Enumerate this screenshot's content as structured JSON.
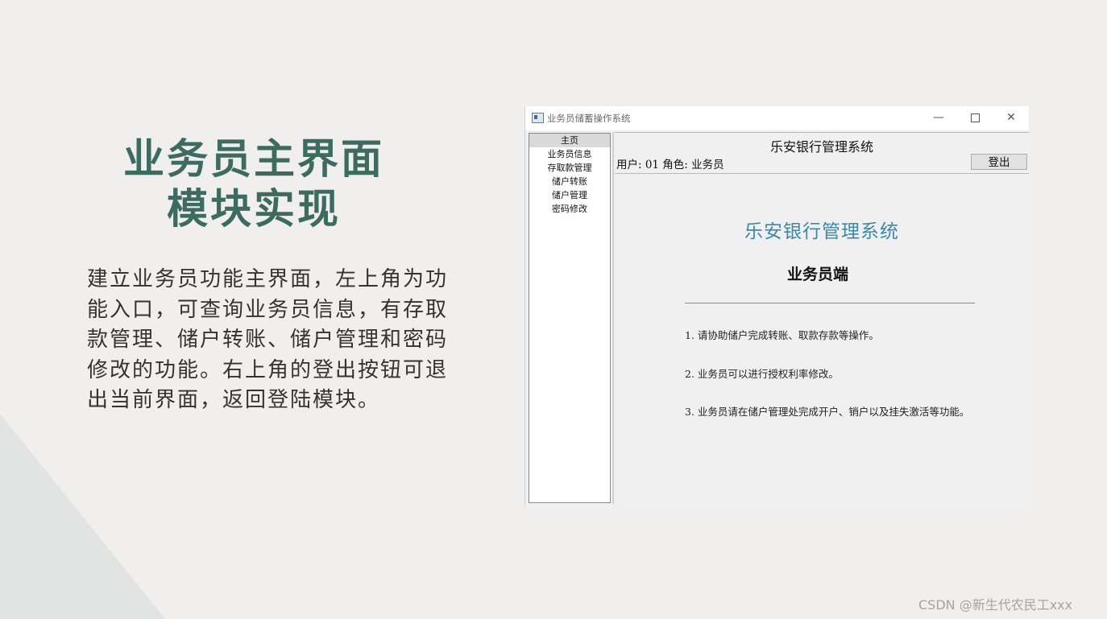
{
  "slide": {
    "title_lines": [
      "业务员主界面",
      "模块实现"
    ],
    "description_lines": [
      "建立业务员功能主界面，左上角为功",
      "能入口，可查询业务员信息，有存取",
      "款管理、储户转账、储户管理和密码",
      "修改的功能。右上角的登出按钮可退",
      "出当前界面，返回登陆模块。"
    ]
  },
  "window": {
    "title": "业务员储蓄操作系统",
    "controls": {
      "minimize": "—",
      "close": "✕"
    }
  },
  "nav": {
    "items": [
      {
        "label": "主页",
        "selected": true
      },
      {
        "label": "业务员信息"
      },
      {
        "label": "存取款管理"
      },
      {
        "label": "储户转账"
      },
      {
        "label": "储户管理"
      },
      {
        "label": "密码修改"
      }
    ]
  },
  "header": {
    "title": "乐安银行管理系统",
    "user_info": "用户: 01 角色: 业务员",
    "logout_label": "登出"
  },
  "content": {
    "system_name": "乐安银行管理系统",
    "subtitle": "业务员端",
    "notes": [
      "1.  请协助储户完成转账、取款存款等操作。",
      "2.  业务员可以进行授权利率修改。",
      "3.  业务员请在储户管理处完成开户、销户以及挂失激活等功能。"
    ]
  },
  "watermark": "CSDN @新生代农民工xxx",
  "colors": {
    "background": "#f1efee",
    "title_green": "#3d6b60",
    "system_name_blue": "#3a89a8"
  }
}
